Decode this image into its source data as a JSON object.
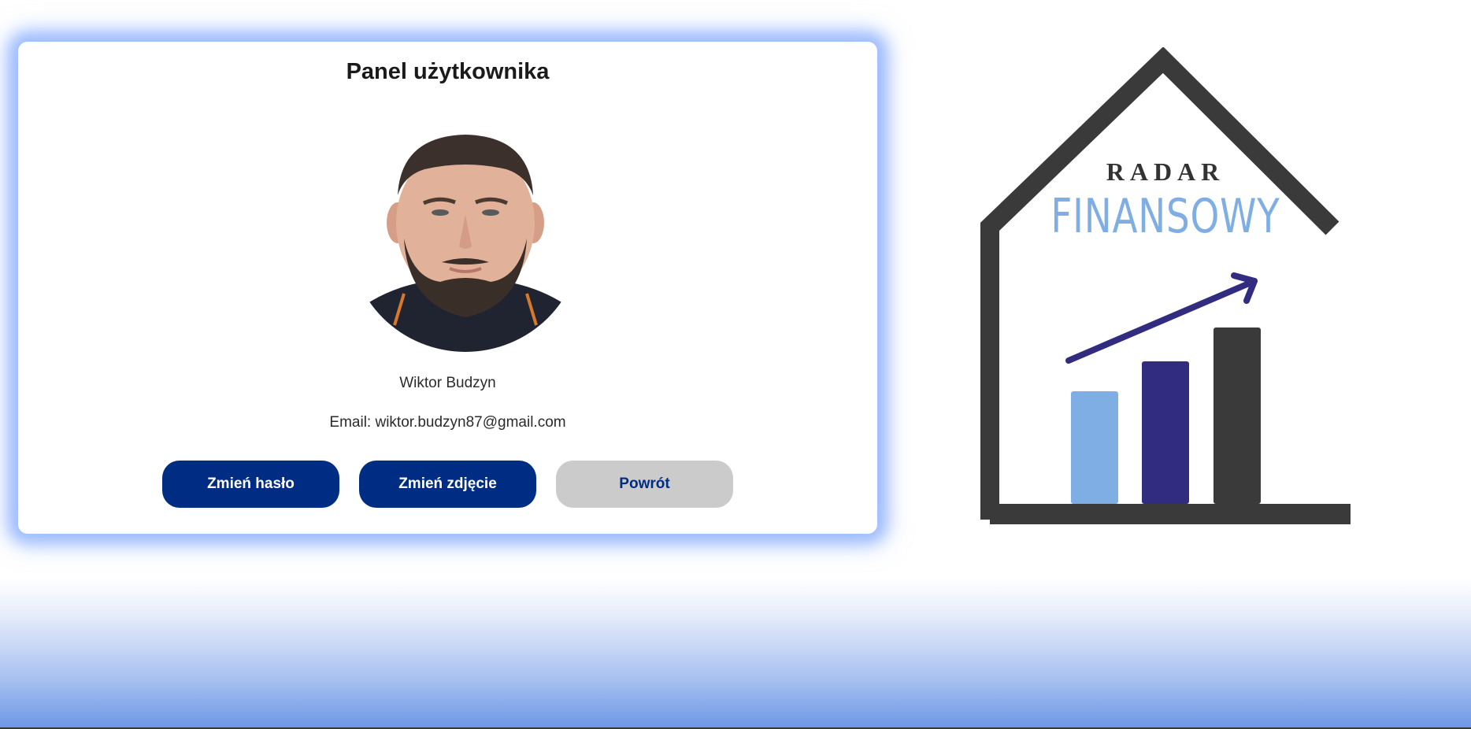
{
  "panel": {
    "title": "Panel użytkownika",
    "user_name": "Wiktor Budzyn",
    "email_line": "Email: wiktor.budzyn87@gmail.com",
    "avatar_icon": "user-photo",
    "buttons": {
      "change_password": "Zmień hasło",
      "change_photo": "Zmień zdjęcie",
      "back": "Powrót"
    }
  },
  "logo": {
    "line1": "RADAR",
    "line2": "FINANSOWY"
  },
  "colors": {
    "primary_button": "#002d84",
    "secondary_button": "#cbcbcb",
    "panel_glow": "#9ebcff",
    "logo_dark": "#3a3a3a",
    "logo_light_blue": "#7eaee3",
    "logo_navy": "#312c80"
  }
}
